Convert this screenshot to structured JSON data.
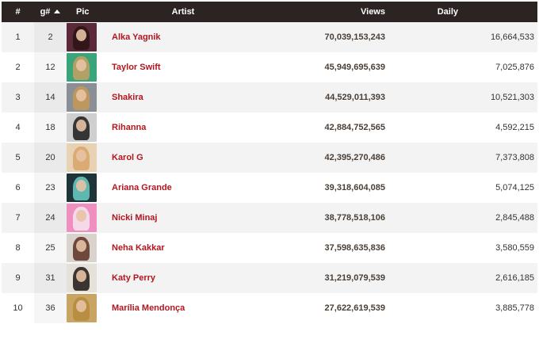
{
  "columns": {
    "rank": "#",
    "g": "g#",
    "pic": "Pic",
    "artist": "Artist",
    "views": "Views",
    "daily": "Daily"
  },
  "rows": [
    {
      "rank": "1",
      "g": "2",
      "artist": "Alka Yagnik",
      "views": "70,039,153,243",
      "daily": "16,664,533",
      "thumb": {
        "bg": "#5a2a3a",
        "hair": "#2a1414"
      }
    },
    {
      "rank": "2",
      "g": "12",
      "artist": "Taylor Swift",
      "views": "45,949,695,639",
      "daily": "7,025,876",
      "thumb": {
        "bg": "#3aa57a",
        "hair": "#c7a060"
      }
    },
    {
      "rank": "3",
      "g": "14",
      "artist": "Shakira",
      "views": "44,529,011,393",
      "daily": "10,521,303",
      "thumb": {
        "bg": "#8a8f96",
        "hair": "#c49a55"
      }
    },
    {
      "rank": "4",
      "g": "18",
      "artist": "Rihanna",
      "views": "42,884,752,565",
      "daily": "4,592,215",
      "thumb": {
        "bg": "#cfcfcf",
        "hair": "#1a1a1a"
      }
    },
    {
      "rank": "5",
      "g": "20",
      "artist": "Karol G",
      "views": "42,395,270,486",
      "daily": "7,373,808",
      "thumb": {
        "bg": "#e8d2b4",
        "hair": "#d7a466"
      }
    },
    {
      "rank": "6",
      "g": "23",
      "artist": "Ariana Grande",
      "views": "39,318,604,085",
      "daily": "5,074,125",
      "thumb": {
        "bg": "#1e3438",
        "hair": "#6ad0c8"
      }
    },
    {
      "rank": "7",
      "g": "24",
      "artist": "Nicki Minaj",
      "views": "38,778,518,106",
      "daily": "2,845,488",
      "thumb": {
        "bg": "#ef8fc0",
        "hair": "#f5e6ef"
      }
    },
    {
      "rank": "8",
      "g": "25",
      "artist": "Neha Kakkar",
      "views": "37,598,635,836",
      "daily": "3,580,559",
      "thumb": {
        "bg": "#d9d3cd",
        "hair": "#5a2f23"
      }
    },
    {
      "rank": "9",
      "g": "31",
      "artist": "Katy Perry",
      "views": "31,219,079,539",
      "daily": "2,616,185",
      "thumb": {
        "bg": "#e5e0da",
        "hair": "#1d1613"
      }
    },
    {
      "rank": "10",
      "g": "36",
      "artist": "Marília Mendonça",
      "views": "27,622,619,539",
      "daily": "3,885,778",
      "thumb": {
        "bg": "#c9a563",
        "hair": "#b48a3c"
      }
    }
  ],
  "colors": {
    "header_bg": "#2b2423",
    "artist_link": "#b0171f",
    "views_text": "#4a3f36",
    "row_alt": "#f3f3f3"
  }
}
